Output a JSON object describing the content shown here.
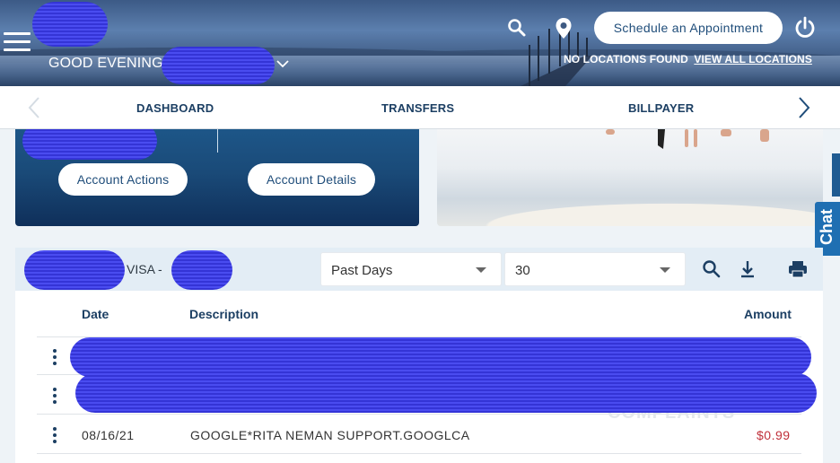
{
  "header": {
    "greeting": "GOOD EVENING",
    "appointment_button": "Schedule an Appointment",
    "locations_status": "NO LOCATIONS FOUND",
    "view_all_locations": "VIEW ALL LOCATIONS",
    "icons": [
      "menu-icon",
      "search-icon",
      "location-pin-icon",
      "power-icon",
      "chevron-down-icon"
    ]
  },
  "nav": {
    "items": [
      {
        "label": "DASHBOARD"
      },
      {
        "label": "TRANSFERS"
      },
      {
        "label": "BILLPAYER"
      }
    ]
  },
  "account_card": {
    "actions_label": "Account Actions",
    "details_label": "Account Details"
  },
  "side_tabs": {
    "chat_label": "Chat"
  },
  "transactions": {
    "account_label": "VISA -",
    "period_filter": "Past Days",
    "period_value": "30",
    "columns": [
      "Date",
      "Description",
      "Amount"
    ],
    "rows": [
      {
        "date": "",
        "description": "",
        "amount": ""
      },
      {
        "date": "",
        "description": "",
        "amount": ""
      },
      {
        "date": "08/16/21",
        "description": "GOOGLE*RITA NEMAN SUPPORT.GOOGLCA",
        "amount": "$0.99"
      }
    ],
    "watermark": "COMPLAINTS"
  },
  "colors": {
    "brand_dark": "#1c3f63",
    "card_blue": "#1a4a78",
    "amount_red": "#c0303a",
    "chat_blue": "#1f6fb2"
  }
}
